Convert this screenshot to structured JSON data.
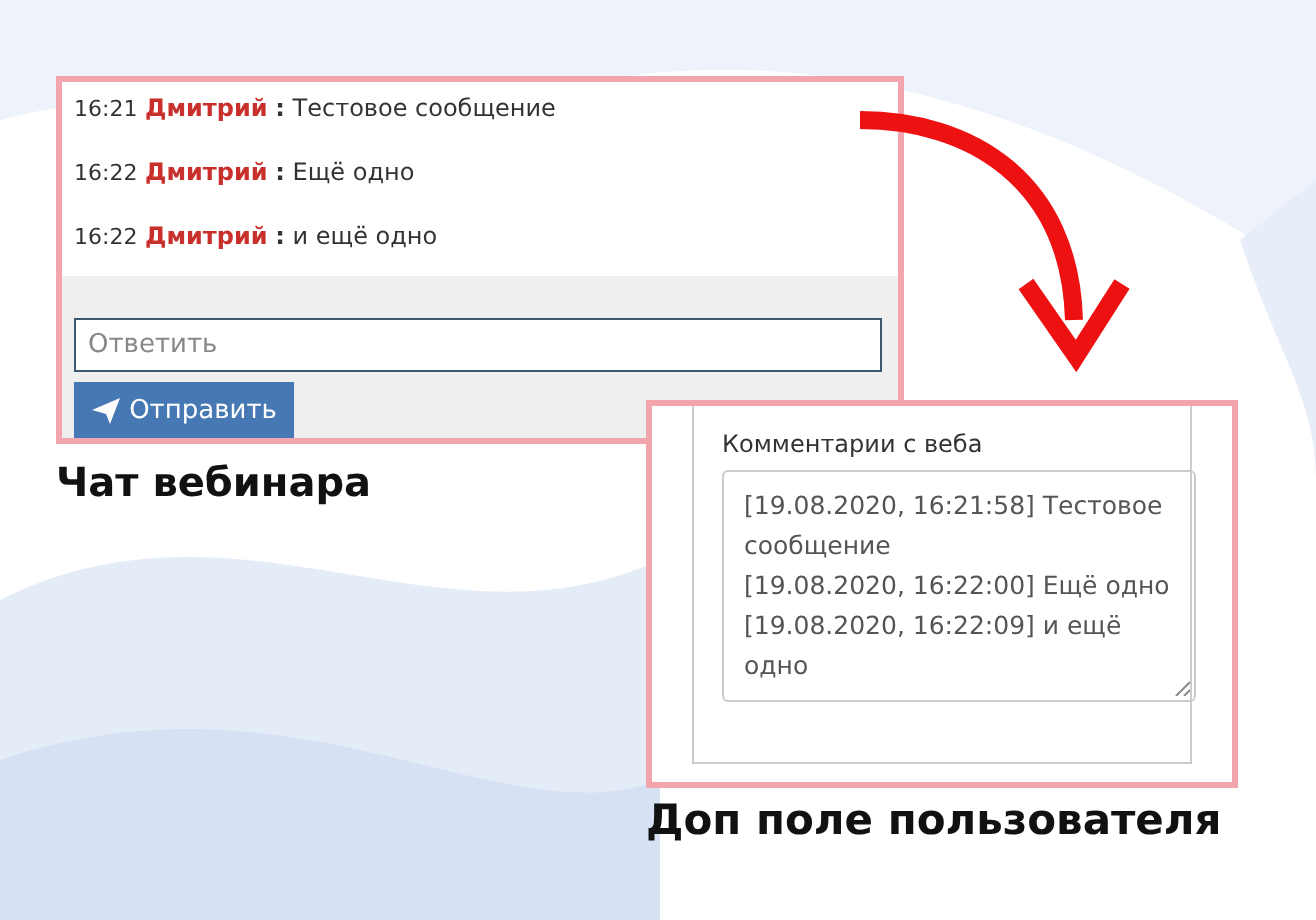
{
  "chat": {
    "messages": [
      {
        "time": "16:21",
        "author": "Дмитрий",
        "separator": ":",
        "text": "Тестовое сообщение"
      },
      {
        "time": "16:22",
        "author": "Дмитрий",
        "separator": ":",
        "text": "Ещё одно"
      },
      {
        "time": "16:22",
        "author": "Дмитрий",
        "separator": ":",
        "text": "и ещё одно"
      }
    ],
    "reply": {
      "placeholder": "Ответить"
    },
    "send_button": "Отправить",
    "caption": "Чат вебинара"
  },
  "user_field": {
    "label": "Комментарии с веба",
    "comments": [
      "[19.08.2020, 16:21:58] Тестовое сообщение",
      "[19.08.2020, 16:22:00] Ещё одно",
      "[19.08.2020, 16:22:09] и ещё одно"
    ],
    "caption": "Доп поле пользователя"
  }
}
